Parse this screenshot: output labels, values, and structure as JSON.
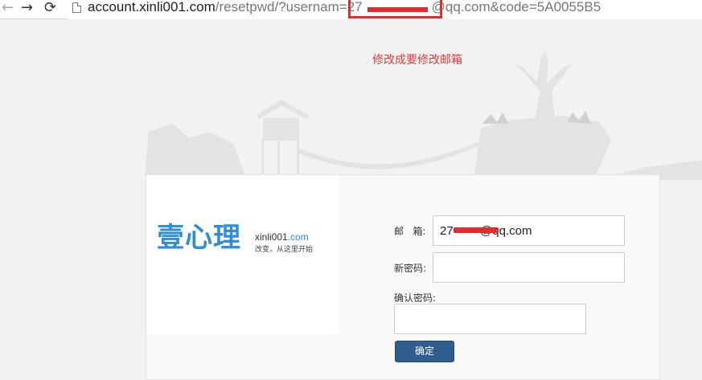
{
  "browser": {
    "url_host": "account.xinli001.com",
    "url_path_before": "/resetpwd/?usernam",
    "url_highlight": "=27",
    "url_rest": "@qq.com&code=5A0055B5"
  },
  "annotation": "修改成要修改邮箱",
  "logo": {
    "main": "壹心理",
    "domain": "xinli001",
    "domain_tld": ".com",
    "slogan": "改变，从这里开始"
  },
  "form": {
    "email_label": "邮   箱:",
    "email_value": "27        @qq.com",
    "new_password_label": "新密码:",
    "new_password_value": "",
    "confirm_password_label": "确认密码:",
    "confirm_password_value": "",
    "submit_label": "确定"
  },
  "colors": {
    "annotation_red": "#e03c3c",
    "logo_blue": "#2e8fd6",
    "button_blue": "#2f5d8e"
  }
}
